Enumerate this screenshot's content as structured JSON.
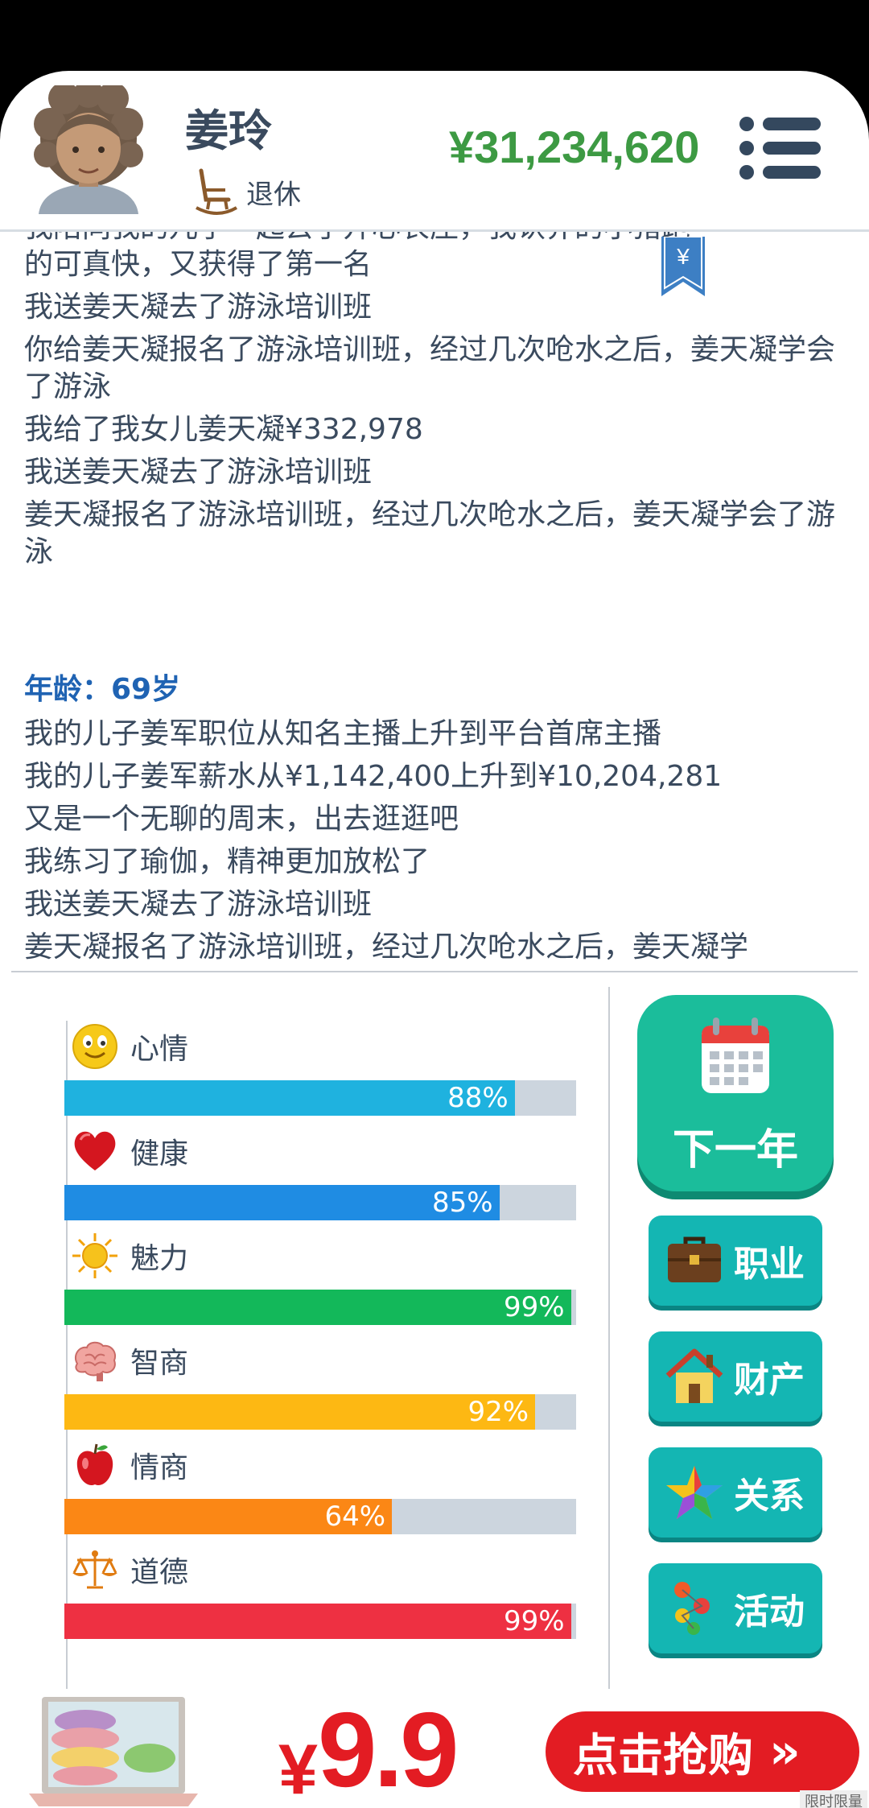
{
  "header": {
    "name": "姜玲",
    "status": "退休",
    "money": "¥31,234,620"
  },
  "log": {
    "entries_before": [
      "我陪同我的儿子一起去了开心农庄，我认养的小猪跑",
      "的可真快，又获得了第一名",
      "我送姜天凝去了游泳培训班",
      "你给姜天凝报名了游泳培训班，经过几次呛水之后，姜天凝学会了游泳",
      "我给了我女儿姜天凝¥332,978",
      "我送姜天凝去了游泳培训班",
      "姜天凝报名了游泳培训班，经过几次呛水之后，姜天凝学会了游泳"
    ],
    "age_title": "年龄：69岁",
    "entries_after": [
      "我的儿子姜军职位从知名主播上升到平台首席主播",
      "我的儿子姜军薪水从¥1,142,400上升到¥10,204,281",
      "又是一个无聊的周末，出去逛逛吧",
      "我练习了瑜伽，精神更加放松了",
      "我送姜天凝去了游泳培训班",
      "姜天凝报名了游泳培训班，经过几次呛水之后，姜天凝学"
    ]
  },
  "stats": [
    {
      "label": "心情",
      "value": 0.88,
      "pct": "88%",
      "color": "#1fb2df",
      "icon": "smiley-icon"
    },
    {
      "label": "健康",
      "value": 0.85,
      "pct": "85%",
      "color": "#1f8ce3",
      "icon": "heart-icon"
    },
    {
      "label": "魅力",
      "value": 0.99,
      "pct": "99%",
      "color": "#13b85a",
      "icon": "sun-icon"
    },
    {
      "label": "智商",
      "value": 0.92,
      "pct": "92%",
      "color": "#fdb813",
      "icon": "brain-icon"
    },
    {
      "label": "情商",
      "value": 0.64,
      "pct": "64%",
      "color": "#fb8715",
      "icon": "apple-icon"
    },
    {
      "label": "道德",
      "value": 0.99,
      "pct": "99%",
      "color": "#ee3042",
      "icon": "scales-icon"
    }
  ],
  "actions": {
    "next_year": "下一年",
    "career": "职业",
    "property": "财产",
    "relationship": "关系",
    "activity": "活动"
  },
  "ad": {
    "yen": "¥",
    "price": "9.9",
    "buy": "点击抢购",
    "buy_arrow": "»",
    "tag": "限时限量"
  }
}
